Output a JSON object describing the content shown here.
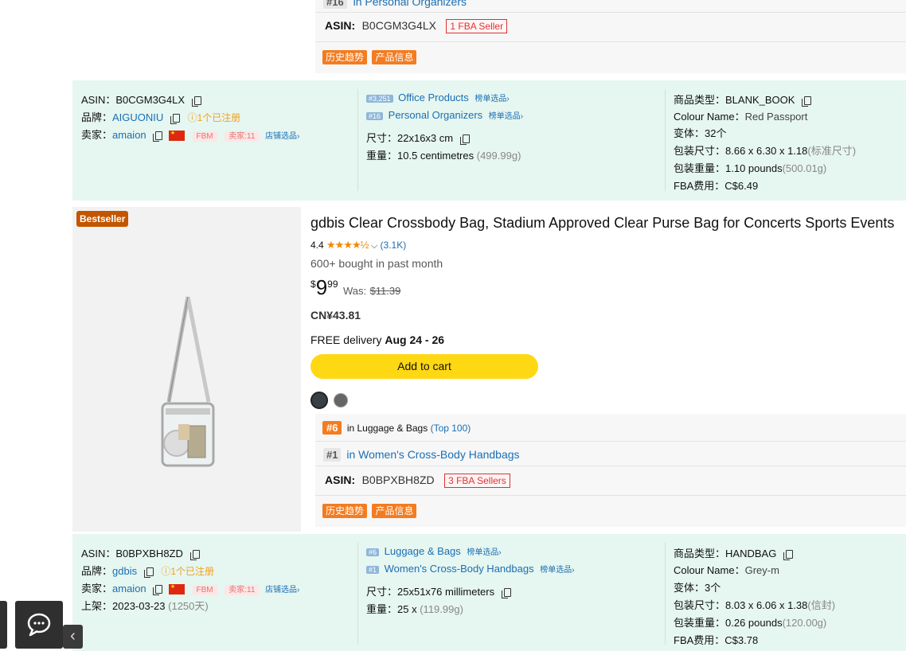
{
  "product1": {
    "rank_partial": "#16",
    "rank_partial_category": "in Personal Organizers",
    "asin_label": "ASIN:",
    "asin": "B0CGM3G4LX",
    "fba_sellers": "1 FBA Seller",
    "btn_history": "历史趋势",
    "btn_product_info": "产品信息",
    "info": {
      "asin_label": "ASIN：",
      "asin": "B0CGM3G4LX",
      "brand_label": "品牌：",
      "brand": "AIGUONIU",
      "brand_status": "ⓘ1个已注册",
      "seller_label": "卖家：",
      "seller": "amaion",
      "fbm": "FBM",
      "seller_count": "卖家:11",
      "store_select": "店铺选品›",
      "rank1_badge": "#3,251",
      "rank1_category": "Office Products",
      "rank1_link": "榜单选品›",
      "rank2_badge": "#16",
      "rank2_category": "Personal Organizers",
      "rank2_link": "榜单选品›",
      "size_label": "尺寸：",
      "size": "22x16x3 cm",
      "weight_label": "重量：",
      "weight": "10.5 centimetres",
      "weight_g": "(499.99g)",
      "type_label": "商品类型：",
      "type": "BLANK_BOOK",
      "colour_label": "Colour Name：",
      "colour": "Red Passport",
      "variants_label": "变体：",
      "variants": "32个",
      "pkg_size_label": "包装尺寸：",
      "pkg_size": "8.66 x 6.30 x 1.18",
      "pkg_size_note": "(标准尺寸)",
      "pkg_weight_label": "包装重量：",
      "pkg_weight": "1.10 pounds",
      "pkg_weight_g": "(500.01g)",
      "fba_label": "FBA费用：",
      "fba_fee": "C$6.49"
    }
  },
  "product2": {
    "bestseller": "Bestseller",
    "title": "gdbis Clear Crossbody Bag, Stadium Approved Clear Purse Bag for Concerts Sports Events",
    "rating": "4.4",
    "stars": "★★★★½",
    "reviews": "(3.1K)",
    "bought": "600+ bought in past month",
    "price_symbol": "$",
    "price_whole": "9",
    "price_fraction": "99",
    "was_label": "Was:",
    "was_price": "$11.39",
    "cny_price": "CN¥43.81",
    "delivery_label": "FREE delivery",
    "delivery_dates": "Aug 24 - 26",
    "add_to_cart": "Add to cart",
    "rank1_num": "#6",
    "rank1_in": "in Luggage & Bags",
    "rank1_top": "(Top 100)",
    "rank2_num": "#1",
    "rank2_category": "in Women's Cross-Body Handbags",
    "asin_label": "ASIN:",
    "asin": "B0BPXBH8ZD",
    "fba_sellers": "3 FBA Sellers",
    "btn_history": "历史趋势",
    "btn_product_info": "产品信息",
    "info": {
      "asin_label": "ASIN：",
      "asin": "B0BPXBH8ZD",
      "brand_label": "品牌：",
      "brand": "gdbis",
      "brand_status": "ⓘ1个已注册",
      "seller_label": "卖家：",
      "seller": "amaion",
      "fbm": "FBM",
      "seller_count": "卖家:11",
      "store_select": "店铺选品›",
      "listed_label": "上架：",
      "listed": "2023-03-23",
      "listed_days": "(1250天)",
      "rank1_badge": "#6",
      "rank1_category": "Luggage & Bags",
      "rank1_link": "榜单选品›",
      "rank2_badge": "#1",
      "rank2_category": "Women's Cross-Body Handbags",
      "rank2_link": "榜单选品›",
      "size_label": "尺寸：",
      "size": "25x51x76 millimeters",
      "weight_label": "重量：",
      "weight": "25 x",
      "weight_g": "(119.99g)",
      "type_label": "商品类型：",
      "type": "HANDBAG",
      "colour_label": "Colour Name：",
      "colour": "Grey-m",
      "variants_label": "变体：",
      "variants": "3个",
      "pkg_size_label": "包装尺寸：",
      "pkg_size": "8.03 x 6.06 x 1.38",
      "pkg_size_note": "(信封)",
      "pkg_weight_label": "包装重量：",
      "pkg_weight": "0.26 pounds",
      "pkg_weight_g": "(120.00g)",
      "fba_label": "FBA费用：",
      "fba_fee": "C$3.78"
    }
  },
  "colors": {
    "accent_orange": "#f47c20",
    "cart_yellow": "#ffd814",
    "link_blue": "#1a6fb5",
    "panel_green": "#e6f6f0",
    "bestseller": "#c45500"
  }
}
